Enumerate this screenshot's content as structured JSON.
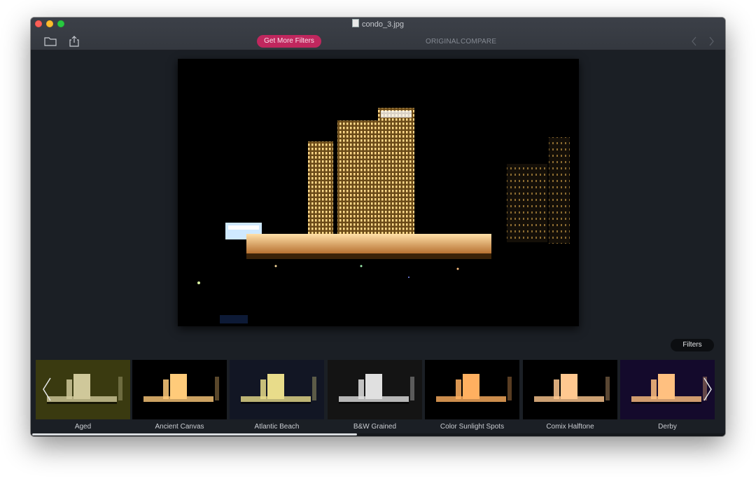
{
  "window": {
    "title": "condo_3.jpg"
  },
  "toolbar": {
    "get_more_filters": "Get More Filters",
    "original": "ORIGINAL",
    "compare": "COMPARE",
    "icons": [
      "folder-icon",
      "share-icon",
      "back-arrow-icon",
      "forward-arrow-icon"
    ]
  },
  "photo": {
    "subject": "condo building at night"
  },
  "panel": {
    "filters_label": "Filters"
  },
  "filters": [
    {
      "label": "Aged",
      "tint": "#3a3a10"
    },
    {
      "label": "Ancient Canvas",
      "tint": "#000000"
    },
    {
      "label": "Atlantic Beach",
      "tint": "#121624"
    },
    {
      "label": "B&W Grained",
      "tint": "#141414"
    },
    {
      "label": "Color Sunlight Spots",
      "tint": "#000000"
    },
    {
      "label": "Comix Halftone",
      "tint": "#000000"
    },
    {
      "label": "Derby",
      "tint": "#140a2c"
    }
  ],
  "colors": {
    "accent": "#c0275e",
    "window_bg": "#1b1f25",
    "titlebar": "#3a3e45"
  },
  "scroll": {
    "position": 0.47
  }
}
